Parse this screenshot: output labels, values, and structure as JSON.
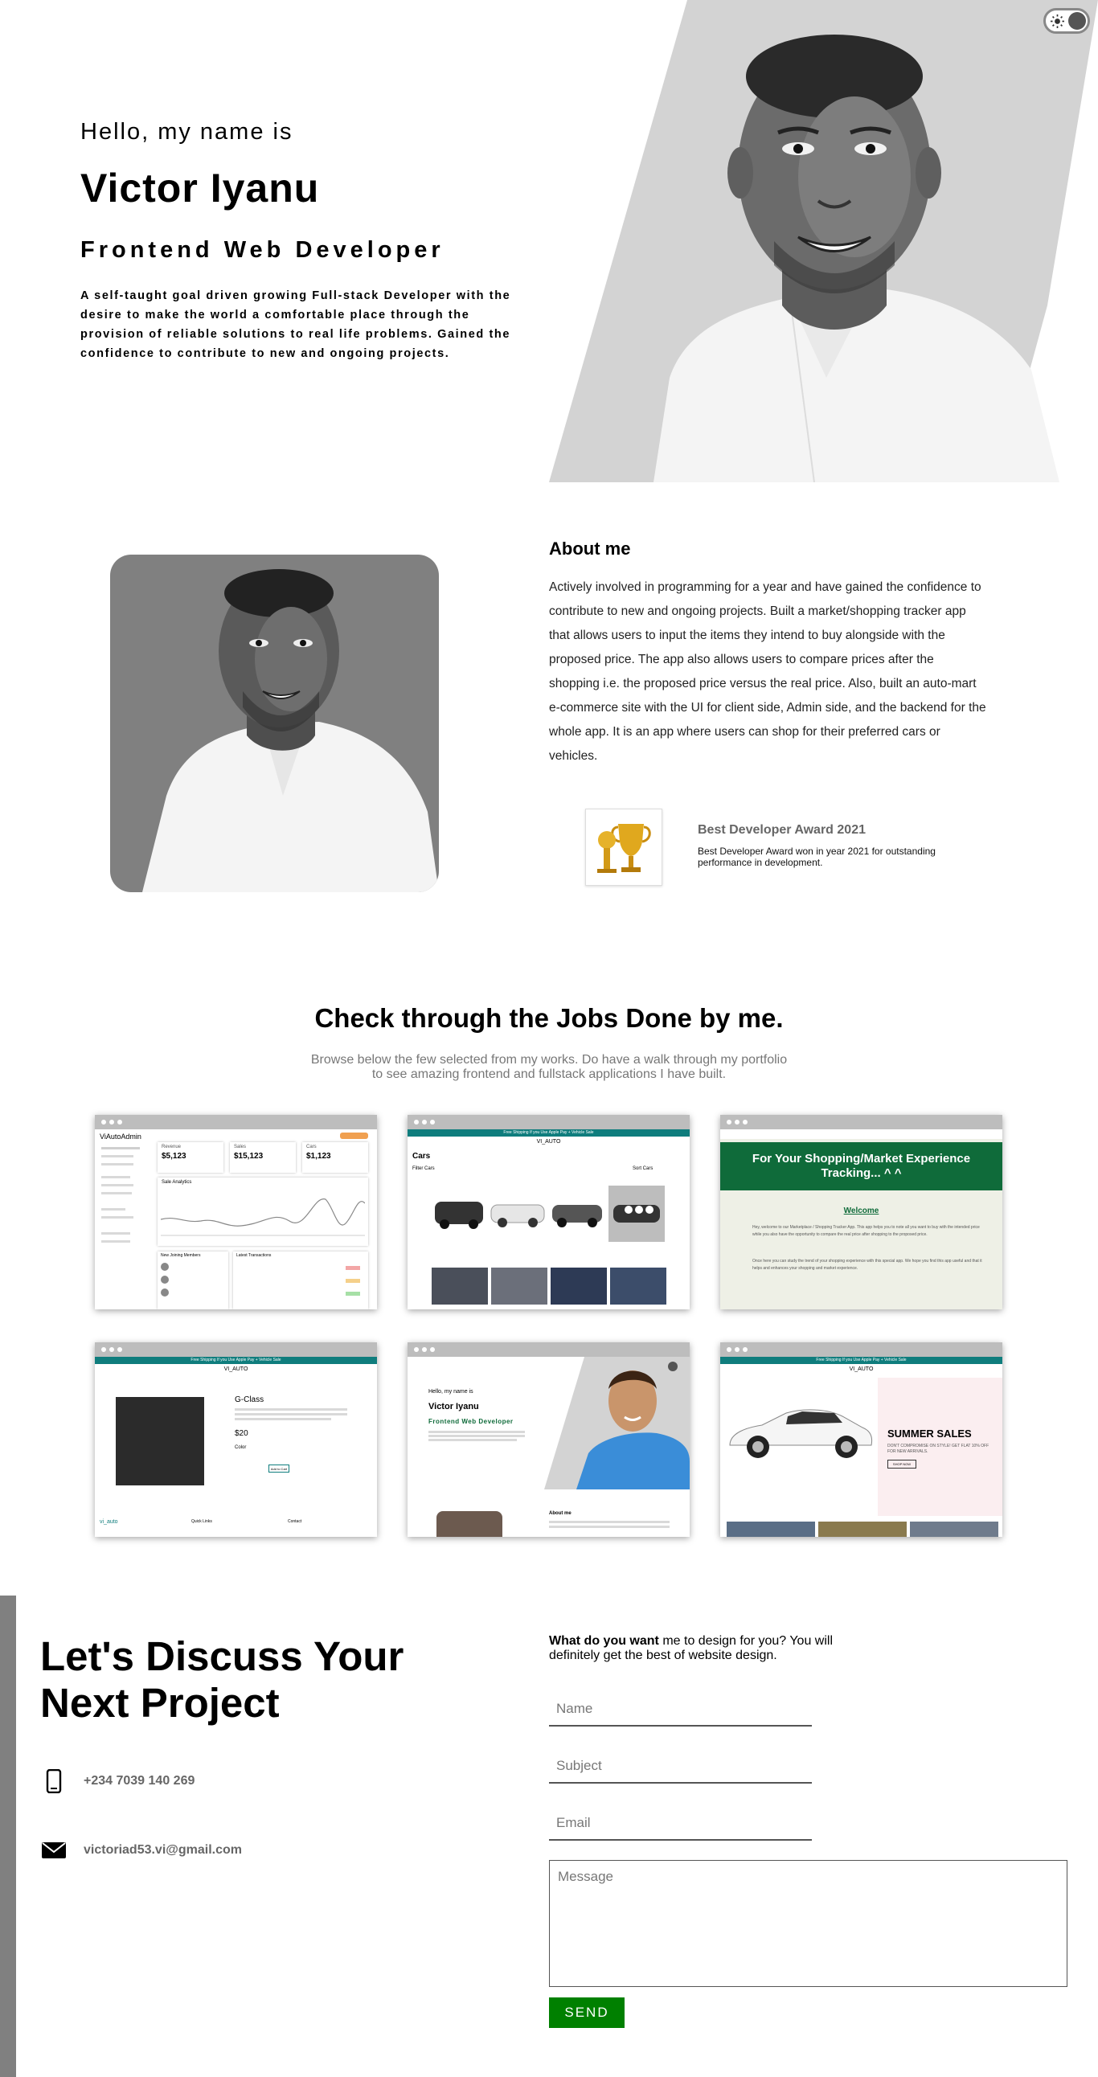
{
  "hero": {
    "greeting": "Hello, my name is",
    "name": "Victor Iyanu",
    "role": "Frontend Web Developer",
    "bio": "A self-taught goal driven growing Full-stack Developer with the desire to make the world a comfortable place through the provision of reliable solutions to real life problems. Gained the confidence to contribute to new and ongoing projects."
  },
  "about": {
    "title": "About me",
    "body": "Actively involved in programming for a year and have gained the confidence to contribute to new and ongoing projects. Built a market/shopping tracker app that allows users to input the items they intend to buy alongside with the proposed price. The app also allows users to compare prices after the shopping i.e. the proposed price versus the real price. Also, built an auto-mart e-commerce site with the UI for client side, Admin side, and the backend for the whole app. It is an app where users can shop for their preferred cars or vehicles.",
    "award_title": "Best Developer Award 2021",
    "award_desc": "Best Developer Award won in year 2021 for outstanding performance in development."
  },
  "works": {
    "title": "Check through the Jobs Done by me.",
    "subtitle": "Browse below the few selected from my works. Do have a walk through my portfolio to see amazing frontend and fullstack applications I have built.",
    "admin": {
      "brand": "ViAutoAdmin",
      "stat1_label": "Revenue",
      "stat1_value": "$5,123",
      "stat2_label": "Sales",
      "stat2_value": "$15,123",
      "stat3_label": "Cars",
      "stat3_value": "$1,123",
      "chart_label": "Sale Analytics",
      "members_label": "New Joining Members",
      "tx_label": "Latest Transactions"
    },
    "cars": {
      "banner": "Free Shipping If you Use Apple Pay + Vehicle Sale",
      "brand": "VI_AUTO",
      "title": "Cars",
      "filter": "Filter Cars",
      "sort": "Sort Cars"
    },
    "tracker": {
      "headline": "For Your Shopping/Market Experience Tracking... ^ ^",
      "welcome": "Welcome",
      "line1": "Hey, welcome to our Marketplace / Shopping Tracker App. This app helps you to note all you want to buy with the intended price while you also have the opportunity to compare the real price after shopping to the proposed price.",
      "line2": "Once here you can study the trend of your shopping experience with this special app. We hope you find this app useful and that it helps and enhances your shopping and market experience."
    },
    "product": {
      "banner": "Free Shipping If you Use Apple Pay + Vehicle Sale",
      "brand": "VI_AUTO",
      "model": "G-Class",
      "price": "$20",
      "color_label": "Color",
      "add_label": "Add to Cart",
      "footer_brand": "vi_auto",
      "footer_col1": "Quick Links",
      "footer_col2": "Contact"
    },
    "portfolio": {
      "greeting": "Hello, my name is",
      "name": "Victor Iyanu",
      "role": "Frontend Web Developer",
      "about": "About me"
    },
    "sale": {
      "banner": "Free Shipping If you Use Apple Pay + Vehicle Sale",
      "brand": "VI_AUTO",
      "title": "SUMMER SALES",
      "desc": "DON'T COMPROMISE ON STYLE! GET FLAT 10% OFF FOR NEW ARRIVALS.",
      "cta": "SHOP NOW"
    }
  },
  "contact": {
    "title": "Let's Discuss Your Next Project",
    "phone": "+234 7039 140 269",
    "email": "victoriad53.vi@gmail.com",
    "intro_bold": "What do you want",
    "intro_rest": " me to design for you? You will definitely get the best of website design.",
    "name_ph": "Name",
    "subject_ph": "Subject",
    "email_ph": "Email",
    "message_ph": "Message",
    "send": "SEND"
  },
  "colors": {
    "accent_green": "#008000",
    "gray_panel": "#d3d3d3",
    "teal": "#0f7d7d"
  }
}
